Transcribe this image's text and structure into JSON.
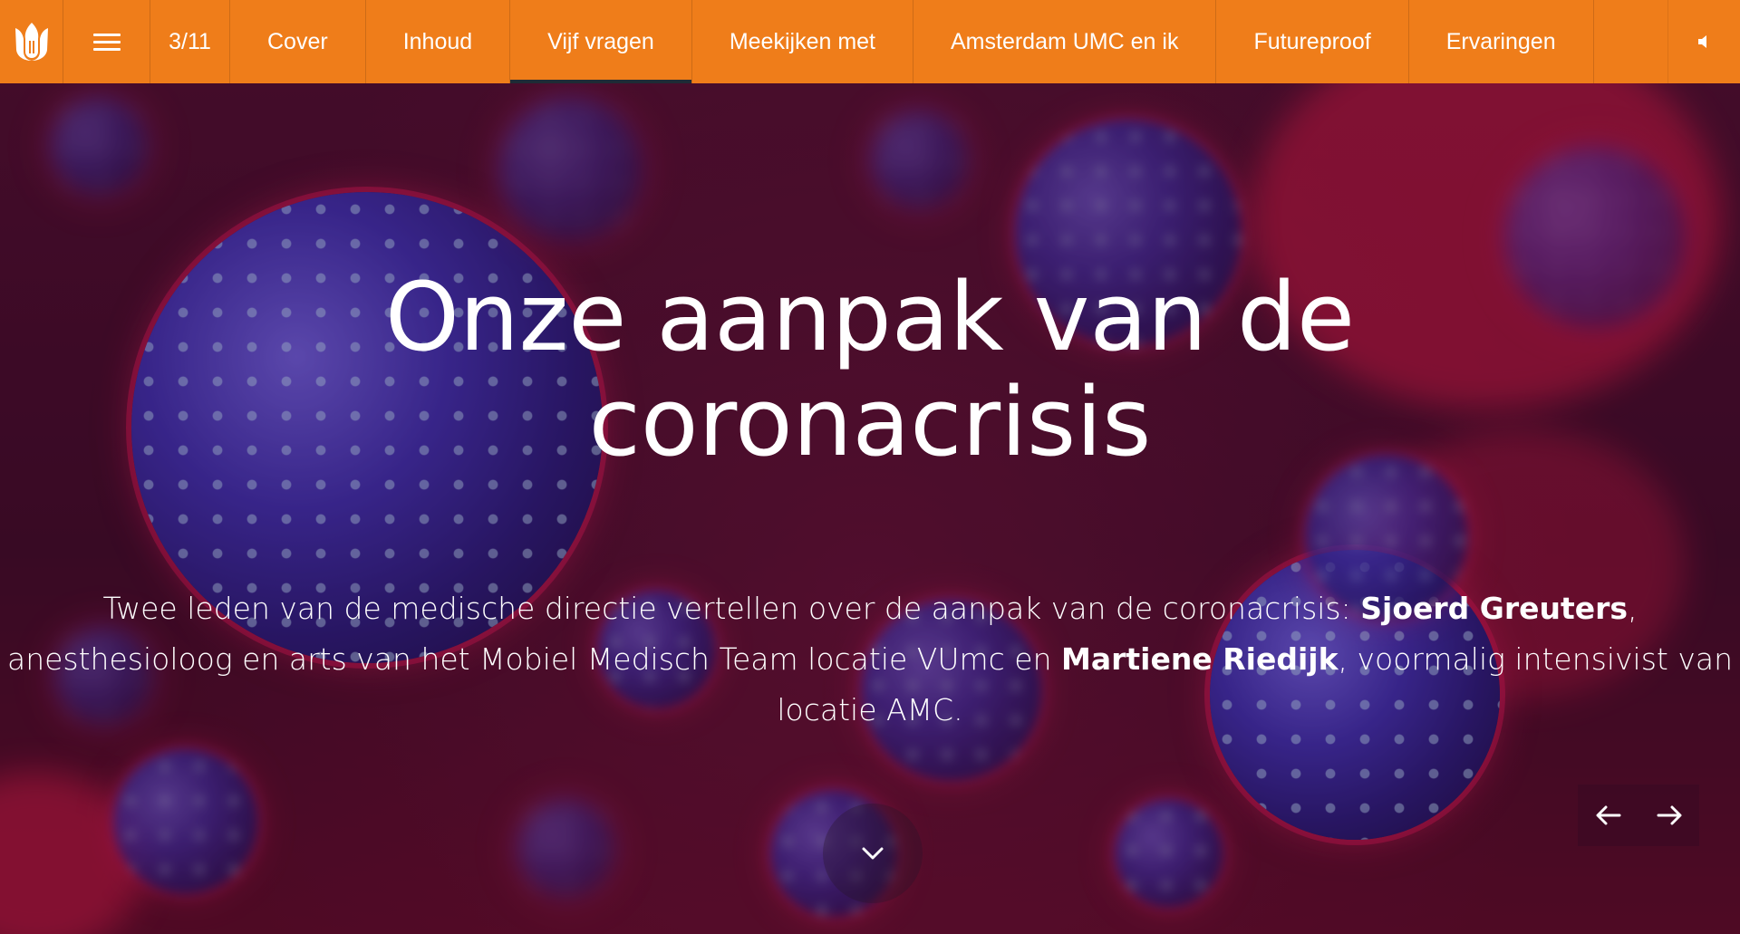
{
  "nav": {
    "page_counter": "3/11",
    "tabs": [
      {
        "label": "Cover"
      },
      {
        "label": "Inhoud"
      },
      {
        "label": "Vijf vragen",
        "active": true
      },
      {
        "label": "Meekijken met"
      },
      {
        "label": "Amsterdam UMC en ik"
      },
      {
        "label": "Futureproof"
      },
      {
        "label": "Ervaringen"
      }
    ],
    "icons": {
      "logo": "tulip-logo-icon",
      "menu": "hamburger-menu-icon",
      "sound": "speaker-icon"
    },
    "colors": {
      "bar": "#ef7d1a",
      "active_underline": "#1f2b35"
    }
  },
  "hero": {
    "title_line1": "Onze aanpak van de",
    "title_line2": "coronacrisis",
    "intro": {
      "p1": "Twee leden van de medische directie vertellen over de aanpak van de coronacrisis: ",
      "name1": "Sjoerd Greuters",
      "p2": ", anesthesioloog en arts van het Mobiel Medisch Team locatie VUmc en ",
      "name2": "Martiene Riedijk",
      "p3": ", voormalig intensivist van locatie AMC."
    },
    "icons": {
      "scroll": "chevron-down-icon",
      "prev": "arrow-left-icon",
      "next": "arrow-right-icon"
    }
  }
}
